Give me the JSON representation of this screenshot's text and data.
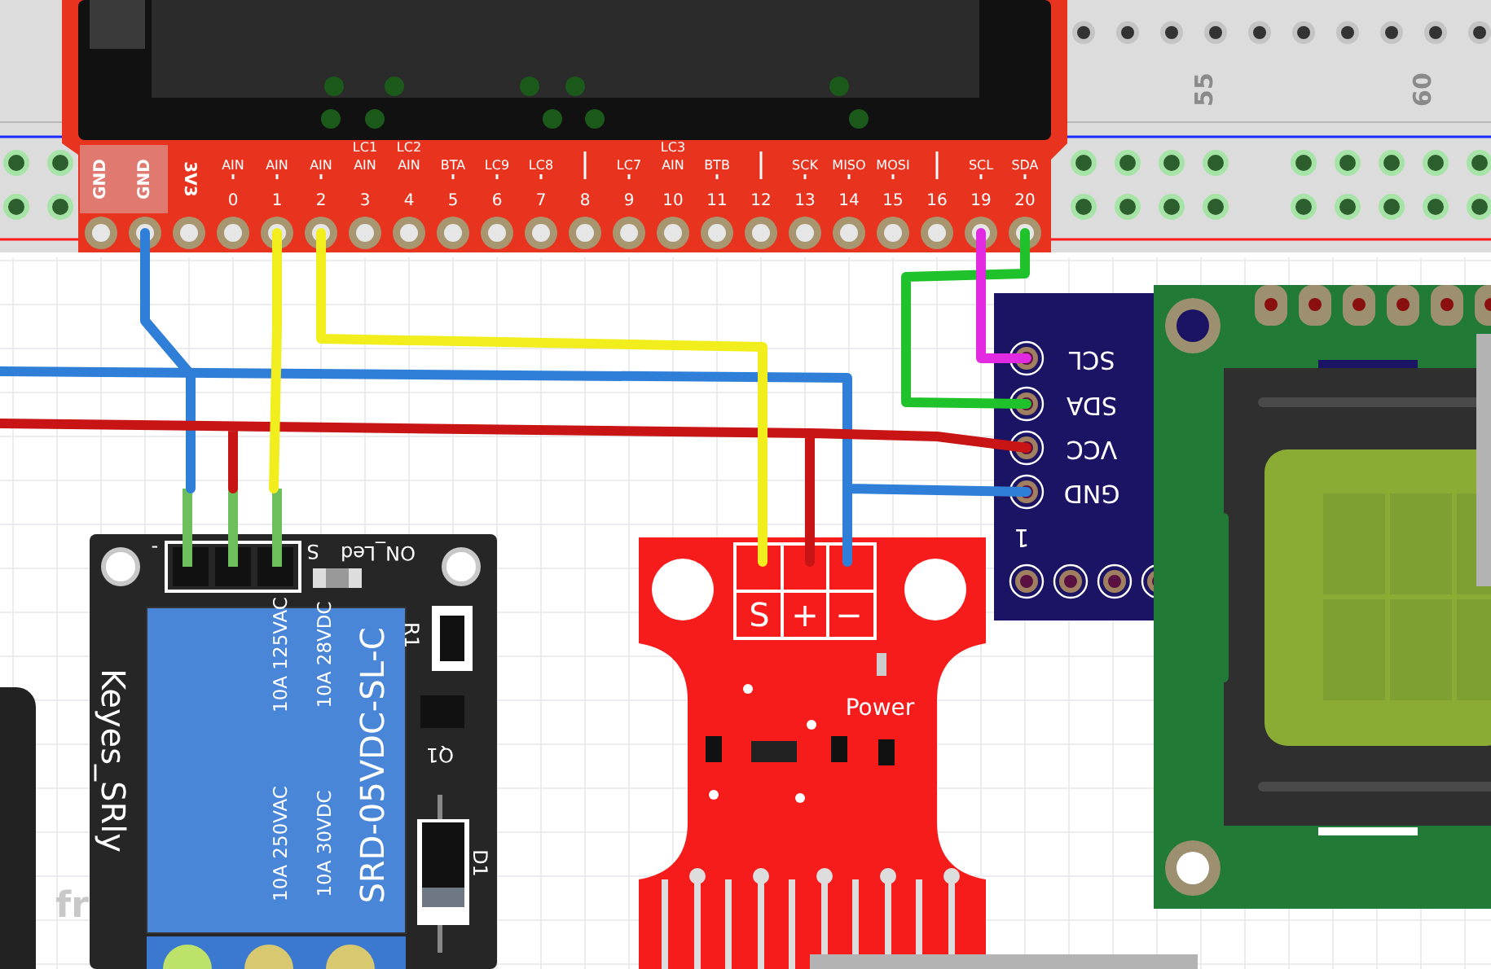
{
  "breadboard": {
    "column_numbers": [
      "55",
      "60"
    ]
  },
  "controller_board": {
    "pins": [
      {
        "kind": "ground",
        "label": "GND"
      },
      {
        "kind": "ground",
        "label": "GND"
      },
      {
        "kind": "power",
        "label": "3V3"
      },
      {
        "kind": "io",
        "number": "0",
        "labels": [
          "AIN"
        ]
      },
      {
        "kind": "io",
        "number": "1",
        "labels": [
          "AIN"
        ]
      },
      {
        "kind": "io",
        "number": "2",
        "labels": [
          "AIN"
        ]
      },
      {
        "kind": "io",
        "number": "3",
        "labels": [
          "LC1",
          "AIN"
        ]
      },
      {
        "kind": "io",
        "number": "4",
        "labels": [
          "LC2",
          "AIN"
        ]
      },
      {
        "kind": "io",
        "number": "5",
        "labels": [
          "BTA"
        ]
      },
      {
        "kind": "io",
        "number": "6",
        "labels": [
          "LC9"
        ]
      },
      {
        "kind": "io",
        "number": "7",
        "labels": [
          "LC8"
        ]
      },
      {
        "kind": "io",
        "number": "8"
      },
      {
        "kind": "io",
        "number": "9",
        "labels": [
          "LC7"
        ]
      },
      {
        "kind": "io",
        "number": "10",
        "labels": [
          "LC3",
          "AIN"
        ]
      },
      {
        "kind": "io",
        "number": "11",
        "labels": [
          "BTB"
        ]
      },
      {
        "kind": "io",
        "number": "12"
      },
      {
        "kind": "io",
        "number": "13",
        "labels": [
          "SCK"
        ]
      },
      {
        "kind": "io",
        "number": "14",
        "labels": [
          "MISO"
        ]
      },
      {
        "kind": "io",
        "number": "15",
        "labels": [
          "MOSI"
        ]
      },
      {
        "kind": "io",
        "number": "16"
      },
      {
        "kind": "io",
        "number": "19",
        "labels": [
          "SCL"
        ]
      },
      {
        "kind": "io",
        "number": "20",
        "labels": [
          "SDA"
        ]
      }
    ]
  },
  "relay_module": {
    "name": "Keyes_SRly",
    "relay_model": "SRD-05VDC-SL-C",
    "ratings": [
      [
        "10A 250VAC",
        "10A 125VAC"
      ],
      [
        "10A 30VDC",
        "10A 28VDC"
      ]
    ],
    "pin_labels": [
      "-",
      "S"
    ],
    "led_label": "ON_Led",
    "designators": [
      "R1",
      "Q1",
      "D1"
    ]
  },
  "water_sensor": {
    "pin_labels": [
      "S",
      "+",
      "−"
    ],
    "led_label": "Power"
  },
  "i2c_adapter": {
    "pin_labels": [
      "SCL",
      "SDA",
      "VCC",
      "GND"
    ],
    "pin_one_label": "1"
  },
  "background_text": "fr",
  "wires": [
    {
      "color": "#2f7fd8"
    },
    {
      "color": "#2f7fd8"
    },
    {
      "color": "#c81414"
    },
    {
      "color": "#f2ee1e"
    },
    {
      "color": "#f2ee1e"
    },
    {
      "color": "#1fc22a"
    },
    {
      "color": "#e22be0"
    }
  ]
}
